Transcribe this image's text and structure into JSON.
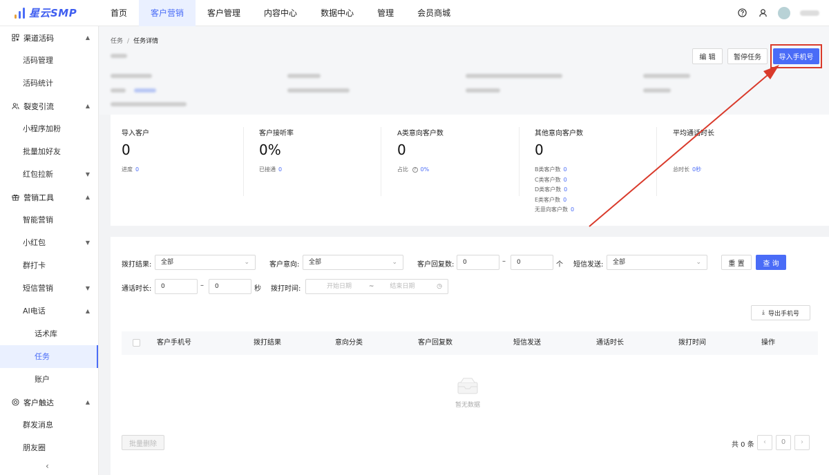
{
  "app": {
    "logo_text": "星云SMP"
  },
  "topnav": [
    "首页",
    "客户营销",
    "客户管理",
    "内容中心",
    "数据中心",
    "管理",
    "会员商城"
  ],
  "sidebar": {
    "g1": "渠道活码",
    "g1_items": [
      "活码管理",
      "活码统计"
    ],
    "g2": "裂变引流",
    "g2_items": [
      "小程序加粉",
      "批量加好友",
      "红包拉新"
    ],
    "g3": "营销工具",
    "g3_items": [
      "智能营销",
      "小红包",
      "群打卡",
      "短信营销",
      "AI电话"
    ],
    "ai_sub": [
      "话术库",
      "任务",
      "账户"
    ],
    "g4": "客户触达",
    "g4_items": [
      "群发消息",
      "朋友圈"
    ]
  },
  "breadcrumb": {
    "parent": "任务",
    "sep": "/",
    "current": "任务详情"
  },
  "actions": {
    "edit": "编 辑",
    "pause": "暂停任务",
    "import": "导入手机号"
  },
  "stats": {
    "import": {
      "title": "导入客户",
      "value": "0",
      "sub_label": "进度",
      "sub_value": "0"
    },
    "answer": {
      "title": "客户接听率",
      "value": "0%",
      "sub_label": "已接通",
      "sub_value": "0"
    },
    "a_class": {
      "title": "A类意向客户数",
      "value": "0",
      "sub_label": "占比",
      "sub_value": "0%"
    },
    "other": {
      "title": "其他意向客户数",
      "value": "0",
      "rows": [
        {
          "label": "B类客户数",
          "value": "0"
        },
        {
          "label": "C类客户数",
          "value": "0"
        },
        {
          "label": "D类客户数",
          "value": "0"
        },
        {
          "label": "E类客户数",
          "value": "0"
        },
        {
          "label": "无意向客户数",
          "value": "0"
        }
      ]
    },
    "avg": {
      "title": "平均通话时长",
      "sub_label": "总时长",
      "sub_value": "0秒"
    }
  },
  "filters": {
    "result_label": "拨打结果:",
    "result_value": "全部",
    "intent_label": "客户意向:",
    "intent_value": "全部",
    "reply_label": "客户回复数:",
    "reply_min": "0",
    "reply_max": "0",
    "reply_unit": "个",
    "sms_label": "短信发送:",
    "sms_value": "全部",
    "reset": "重 置",
    "query": "查 询",
    "duration_label": "通话时长:",
    "duration_min": "0",
    "duration_max": "0",
    "duration_unit": "秒",
    "time_label": "拨打时间:",
    "start_ph": "开始日期",
    "end_ph": "结束日期",
    "dash": "–",
    "tilde": "~"
  },
  "export_label": "导出手机号",
  "table": {
    "columns": [
      "客户手机号",
      "拨打结果",
      "意向分类",
      "客户回复数",
      "短信发送",
      "通话时长",
      "拨打时间",
      "操作"
    ],
    "empty": "暂无数据"
  },
  "footer": {
    "batch_delete": "批量删除",
    "total": "共 0 条",
    "page": "0"
  }
}
